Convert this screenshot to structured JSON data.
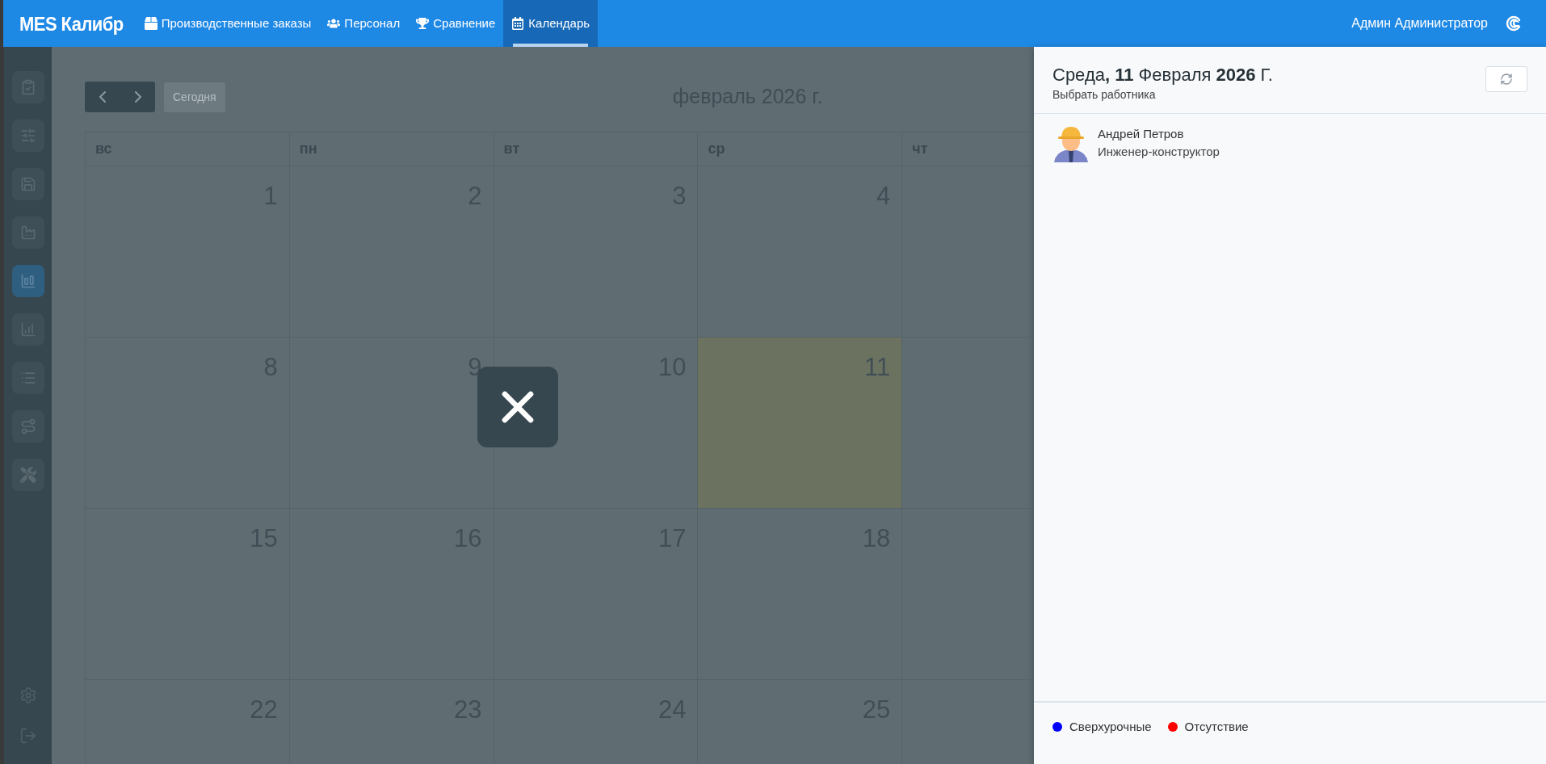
{
  "topbar": {
    "brand": "MES Калибр",
    "tabs": [
      {
        "label": "Производственные заказы",
        "selected": false
      },
      {
        "label": "Персонал",
        "selected": false
      },
      {
        "label": "Сравнение",
        "selected": false
      },
      {
        "label": "Календарь",
        "selected": true
      }
    ],
    "user": "Админ Администратор"
  },
  "sidebar": {
    "items": [
      {
        "selected": false
      },
      {
        "selected": false
      },
      {
        "selected": false
      },
      {
        "selected": false
      },
      {
        "selected": true
      },
      {
        "selected": false
      },
      {
        "selected": false
      },
      {
        "selected": false
      },
      {
        "selected": false
      }
    ]
  },
  "calendar": {
    "today_button": "Сегодня",
    "title": "февраль 2026 г.",
    "columns": [
      "вс",
      "пн",
      "вт",
      "ср",
      "чт"
    ],
    "weeks": [
      {
        "days": [
          {
            "day": "1",
            "today": false
          },
          {
            "day": "2",
            "today": false
          },
          {
            "day": "3",
            "today": false
          },
          {
            "day": "4",
            "today": false
          }
        ]
      },
      {
        "days": [
          {
            "day": "8",
            "today": false
          },
          {
            "day": "9",
            "today": false
          },
          {
            "day": "10",
            "today": false
          },
          {
            "day": "11",
            "today": true
          }
        ]
      },
      {
        "days": [
          {
            "day": "15",
            "today": false
          },
          {
            "day": "16",
            "today": false
          },
          {
            "day": "17",
            "today": false
          },
          {
            "day": "18",
            "today": false
          }
        ]
      },
      {
        "days": [
          {
            "day": "22",
            "today": false
          },
          {
            "day": "23",
            "today": false
          },
          {
            "day": "24",
            "today": false
          },
          {
            "day": "25",
            "today": false
          }
        ]
      }
    ]
  },
  "panel": {
    "title": "Среда**, 11** Февраля **2026** Г.",
    "subtitle": "Выбрать работника",
    "employees": [
      {
        "name": "Андрей Петров",
        "role": "Инженер-конструктор"
      }
    ],
    "legend": [
      {
        "label": "Сверхурочные",
        "color": "#0000ff"
      },
      {
        "label": "Отсутствие",
        "color": "#ff0000"
      }
    ]
  }
}
